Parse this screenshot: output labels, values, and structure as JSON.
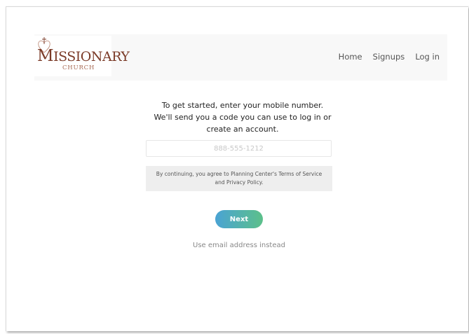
{
  "brand": {
    "logo_main_first": "M",
    "logo_main_rest": "ISSIONARY",
    "logo_sub": "CHURCH",
    "colors": {
      "logo": "#7b3b28",
      "button_start": "#4aa3d4",
      "button_end": "#5cc08a"
    }
  },
  "nav": {
    "items": [
      {
        "label": "Home"
      },
      {
        "label": "Signups"
      },
      {
        "label": "Log in"
      }
    ]
  },
  "login": {
    "intro_line1": "To get started, enter your mobile number.",
    "intro_line2": "We'll send you a code you can use to log in or create an account.",
    "phone_placeholder": "888-555-1212",
    "terms_text": "By continuing, you agree to Planning Center's Terms of Service and Privacy Policy.",
    "next_label": "Next",
    "alt_link": "Use email address instead"
  }
}
